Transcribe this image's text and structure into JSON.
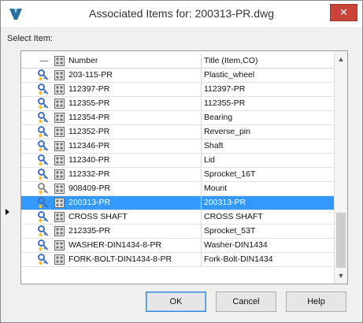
{
  "window": {
    "title": "Associated Items for: 200313-PR.dwg",
    "close_symbol": "✕",
    "app_icon": "autodesk-vault-icon"
  },
  "select_label": "Select Item:",
  "columns": {
    "collapse_symbol": "—",
    "number": "Number",
    "title": "Title (Item,CO)"
  },
  "rows": [
    {
      "number": "203-115-PR",
      "title": "Plastic_wheel",
      "key_color": "#3f6fc0"
    },
    {
      "number": "112397-PR",
      "title": "112397-PR",
      "key_color": "#3f6fc0"
    },
    {
      "number": "112355-PR",
      "title": "112355-PR",
      "key_color": "#3f6fc0"
    },
    {
      "number": "112354-PR",
      "title": "Bearing",
      "key_color": "#3f6fc0"
    },
    {
      "number": "112352-PR",
      "title": "Reverse_pin",
      "key_color": "#3f6fc0"
    },
    {
      "number": "112346-PR",
      "title": "Shaft",
      "key_color": "#3f6fc0"
    },
    {
      "number": "112340-PR",
      "title": "Lid",
      "key_color": "#3f6fc0"
    },
    {
      "number": "112332-PR",
      "title": "Sprocket_16T",
      "key_color": "#3f6fc0"
    },
    {
      "number": "908409-PR",
      "title": "Mount",
      "key_color": "#8a8a8a"
    },
    {
      "number": "200313-PR",
      "title": "200313-PR",
      "key_color": "#3f6fc0",
      "selected": true
    },
    {
      "number": "CROSS SHAFT",
      "title": "CROSS SHAFT",
      "key_color": "#3f6fc0"
    },
    {
      "number": "212335-PR",
      "title": "Sprocket_53T",
      "key_color": "#3f6fc0"
    },
    {
      "number": "WASHER-DIN1434-8-PR",
      "title": "Washer-DIN1434",
      "key_color": "#3f6fc0"
    },
    {
      "number": "FORK-BOLT-DIN1434-8-PR",
      "title": "Fork-Bolt-DIN1434",
      "key_color": "#3f6fc0"
    }
  ],
  "scrollbar": {
    "up_symbol": "▲",
    "down_symbol": "▼"
  },
  "buttons": {
    "ok": "OK",
    "cancel": "Cancel",
    "help": "Help"
  },
  "colors": {
    "selection": "#3399ff",
    "close": "#c9453b"
  }
}
